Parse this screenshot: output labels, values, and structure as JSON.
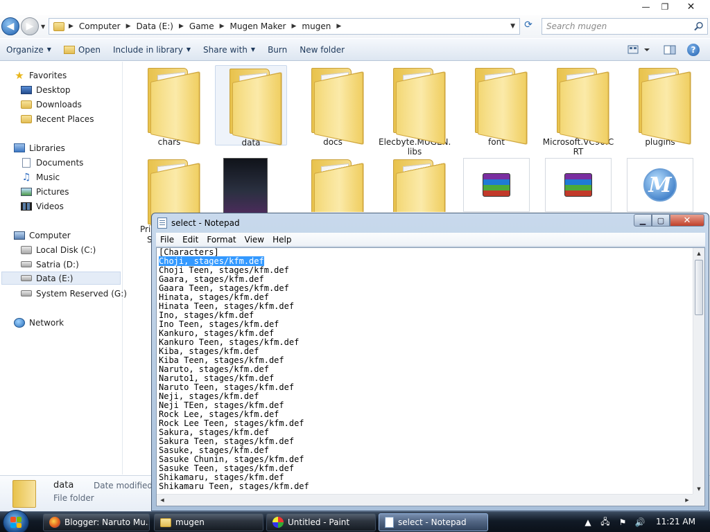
{
  "explorer": {
    "window_controls": {
      "minimize": "—",
      "maximize": "❐",
      "close": "✕"
    },
    "address": {
      "crumbs": [
        "Computer",
        "Data (E:)",
        "Game",
        "Mugen Maker",
        "mugen"
      ]
    },
    "search": {
      "placeholder": "Search mugen"
    },
    "toolbar": {
      "organize": "Organize",
      "open": "Open",
      "include_in_library": "Include in library",
      "share_with": "Share with",
      "burn": "Burn",
      "new_folder": "New folder"
    },
    "nav": {
      "favorites": "Favorites",
      "desktop": "Desktop",
      "downloads": "Downloads",
      "recent_places": "Recent Places",
      "libraries": "Libraries",
      "documents": "Documents",
      "music": "Music",
      "pictures": "Pictures",
      "videos": "Videos",
      "computer": "Computer",
      "local_disk": "Local Disk (C:)",
      "satria": "Satria (D:)",
      "data_e": "Data (E:)",
      "system_reserved": "System Reserved (G:)",
      "network": "Network"
    },
    "items": {
      "chars": "chars",
      "data": "data",
      "docs": "docs",
      "elecbyte": "Elecbyte.MUGEN.\nlibs",
      "font": "font",
      "microsoft": "Microsoft.VC90.C\nRT",
      "plugins": "plugins",
      "partial_1": "Pri",
      "partial_2": "S"
    },
    "details": {
      "name": "data",
      "type": "File folder",
      "modified_label": "Date modified:"
    }
  },
  "notepad": {
    "title": "select - Notepad",
    "controls": {
      "minimize": "▁",
      "maximize": "▢",
      "close": "✕"
    },
    "menu": [
      "File",
      "Edit",
      "Format",
      "View",
      "Help"
    ],
    "lines": [
      "[Characters]",
      "Choji, stages/kfm.def",
      "Choji Teen, stages/kfm.def",
      "Gaara, stages/kfm.def",
      "Gaara Teen, stages/kfm.def",
      "Hinata, stages/kfm.def",
      "Hinata Teen, stages/kfm.def",
      "Ino, stages/kfm.def",
      "Ino Teen, stages/kfm.def",
      "Kankuro, stages/kfm.def",
      "Kankuro Teen, stages/kfm.def",
      "Kiba, stages/kfm.def",
      "Kiba Teen, stages/kfm.def",
      "Naruto, stages/kfm.def",
      "Naruto1, stages/kfm.def",
      "Naruto Teen, stages/kfm.def",
      "Neji, stages/kfm.def",
      "Neji TEen, stages/kfm.def",
      "Rock Lee, stages/kfm.def",
      "Rock Lee Teen, stages/kfm.def",
      "Sakura, stages/kfm.def",
      "Sakura Teen, stages/kfm.def",
      "Sasuke, stages/kfm.def",
      "Sasuke Chunin, stages/kfm.def",
      "Sasuke Teen, stages/kfm.def",
      "Shikamaru, stages/kfm.def",
      "Shikamaru Teen, stages/kfm.def"
    ],
    "selected_line": 1
  },
  "taskbar": {
    "buttons": [
      "Blogger: Naruto Mu...",
      "mugen",
      "Untitled - Paint",
      "select - Notepad"
    ],
    "clock": "11:21 AM"
  }
}
